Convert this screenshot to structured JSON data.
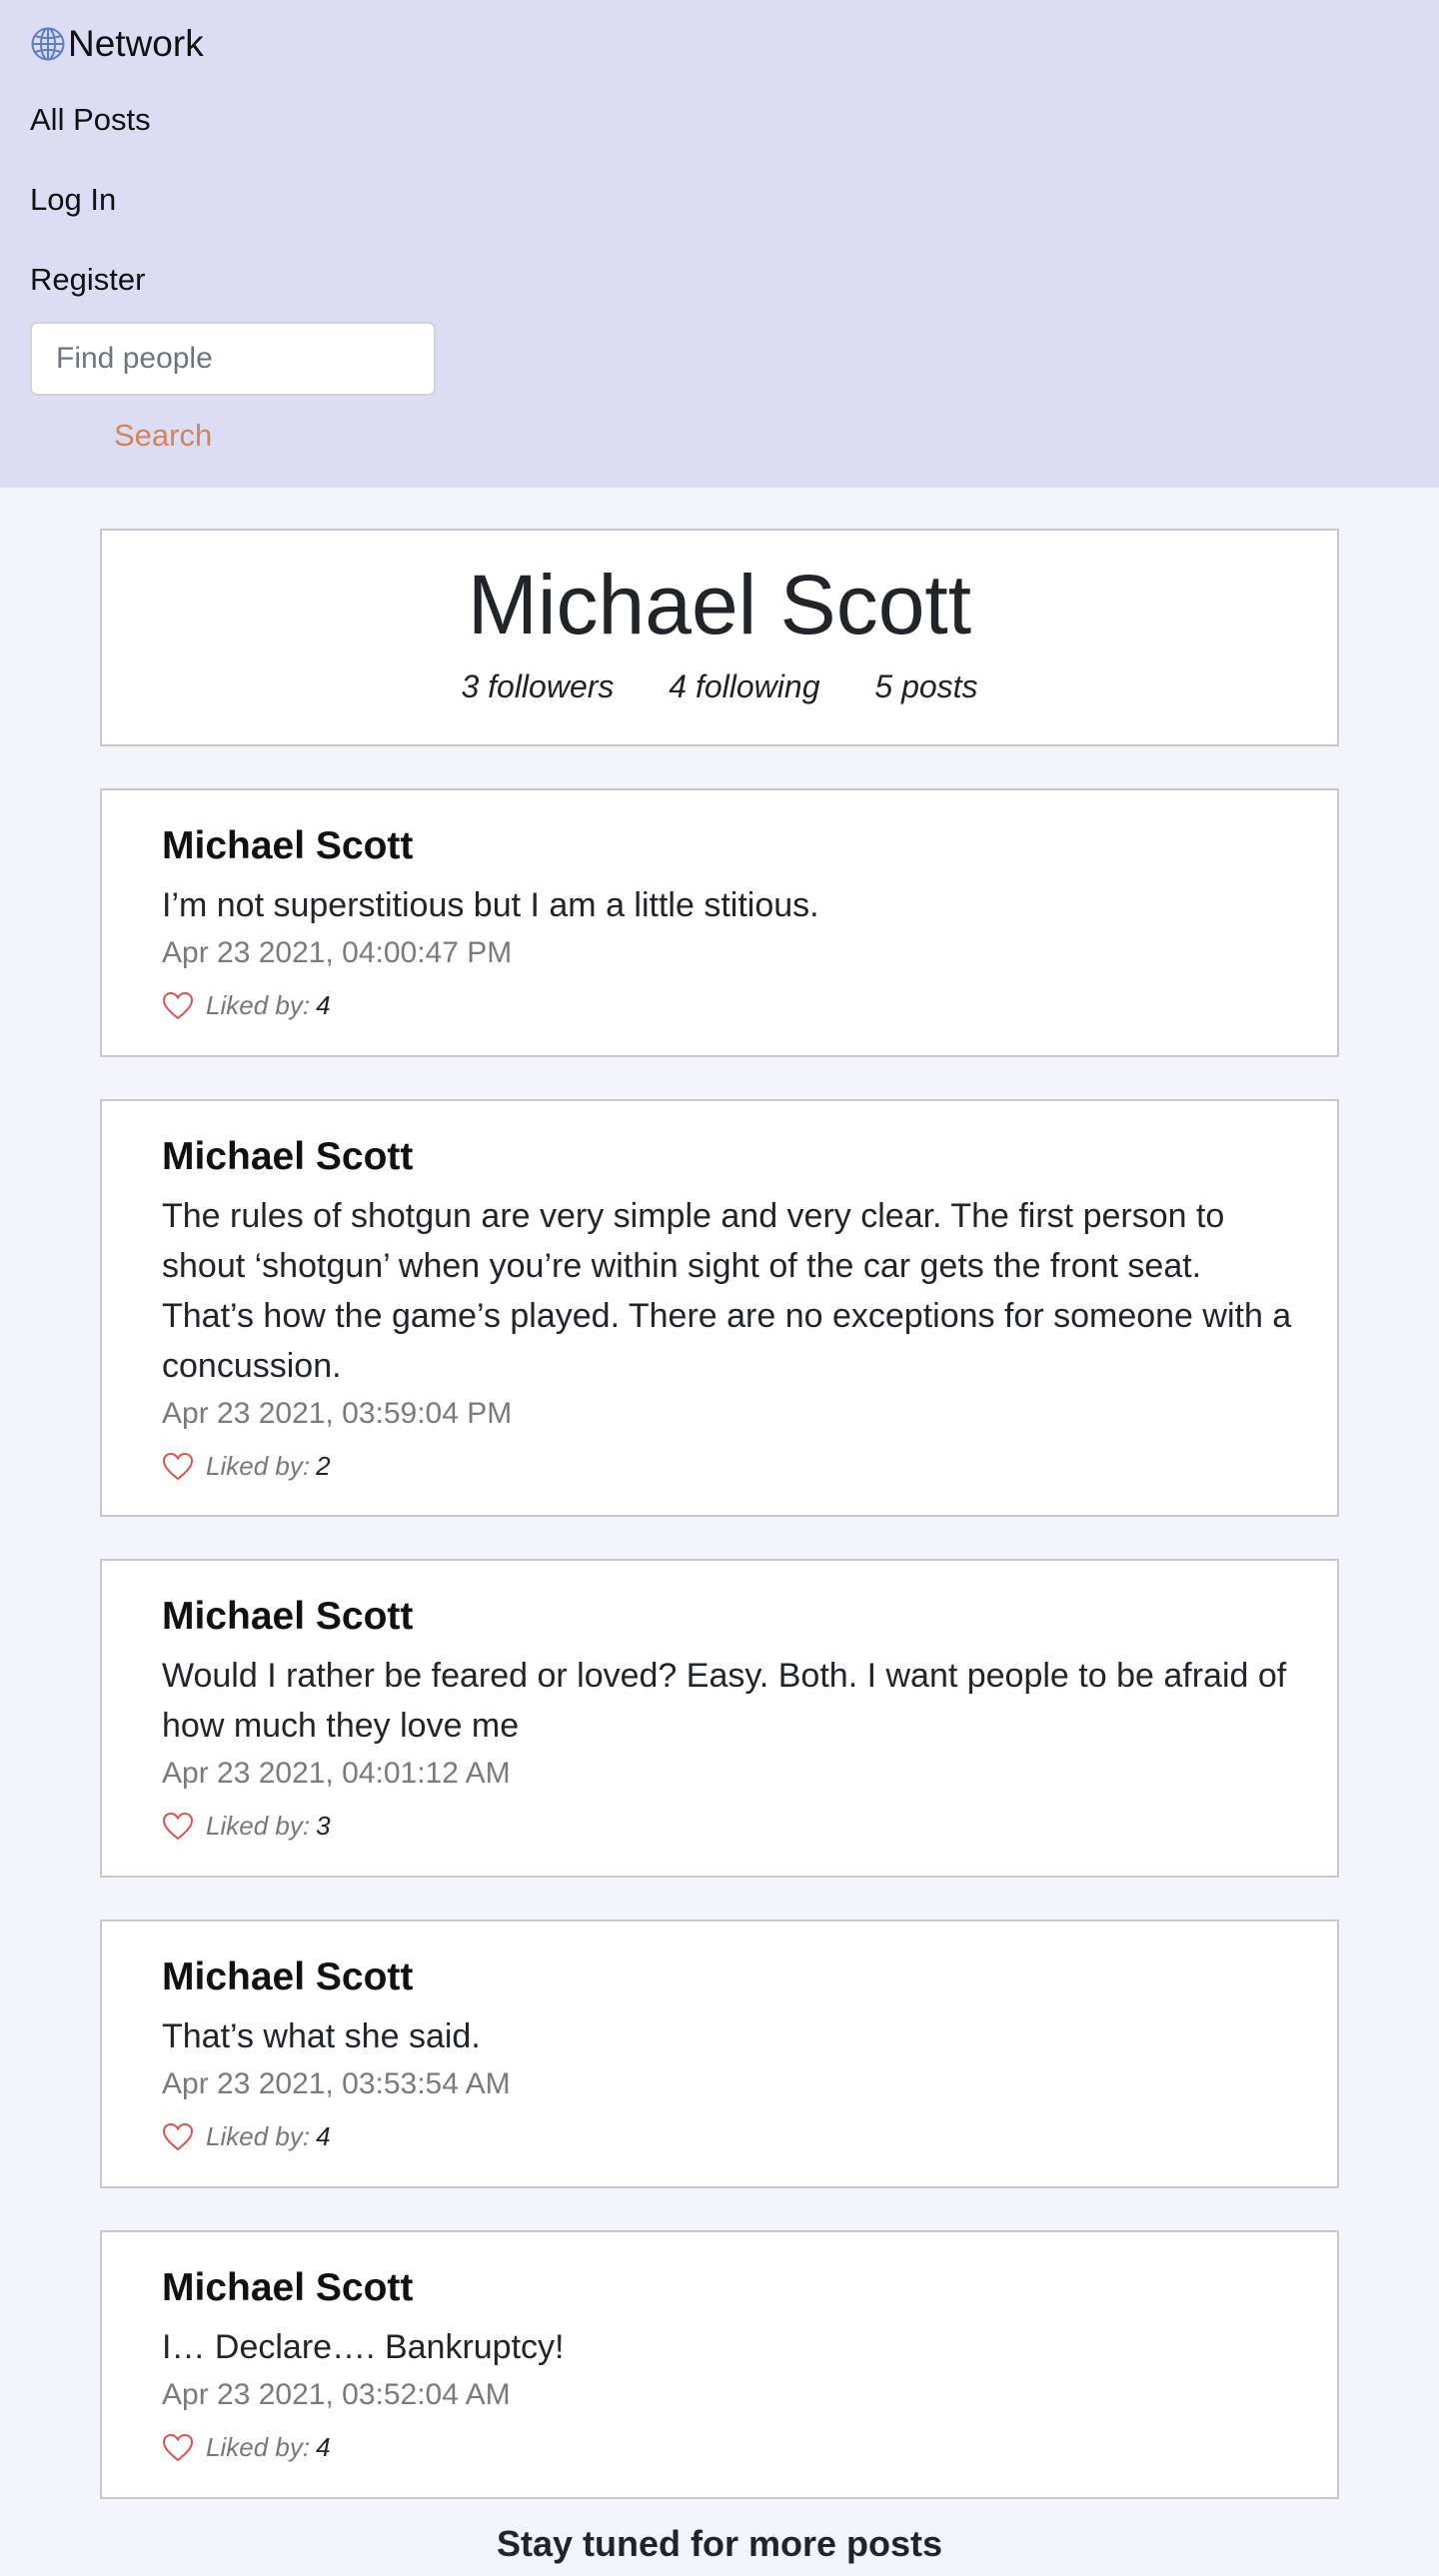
{
  "nav": {
    "brand": "Network",
    "all_posts": "All Posts",
    "log_in": "Log In",
    "register": "Register",
    "search_placeholder": "Find people",
    "search_button": "Search"
  },
  "profile": {
    "name": "Michael Scott",
    "followers": "3 followers",
    "following": "4 following",
    "posts": "5 posts"
  },
  "posts": [
    {
      "author": "Michael Scott",
      "body": "I’m not superstitious but I am a little stitious.",
      "timestamp": "Apr 23 2021, 04:00:47 PM",
      "liked_by_label": "Liked by:",
      "likes": "4"
    },
    {
      "author": "Michael Scott",
      "body": "The rules of shotgun are very simple and very clear. The first person to shout ‘shotgun’ when you’re within sight of the car gets the front seat. That’s how the game’s played. There are no exceptions for someone with a concussion.",
      "timestamp": "Apr 23 2021, 03:59:04 PM",
      "liked_by_label": "Liked by:",
      "likes": "2"
    },
    {
      "author": "Michael Scott",
      "body": "Would I rather be feared or loved? Easy. Both. I want people to be afraid of how much they love me",
      "timestamp": "Apr 23 2021, 04:01:12 AM",
      "liked_by_label": "Liked by:",
      "likes": "3"
    },
    {
      "author": "Michael Scott",
      "body": "That’s what she said.",
      "timestamp": "Apr 23 2021, 03:53:54 AM",
      "liked_by_label": "Liked by:",
      "likes": "4"
    },
    {
      "author": "Michael Scott",
      "body": "I… Declare…. Bankruptcy!",
      "timestamp": "Apr 23 2021, 03:52:04 AM",
      "liked_by_label": "Liked by:",
      "likes": "4"
    }
  ],
  "footer": "Stay tuned for more posts",
  "colors": {
    "navbar_bg": "#dcdcf5",
    "page_bg": "#f4f4fb",
    "search_accent": "#d0855a",
    "heart": "#d9534f",
    "globe": "#5b7fc4"
  },
  "icons": {
    "brand": "globe-icon",
    "like": "heart-outline-icon"
  }
}
